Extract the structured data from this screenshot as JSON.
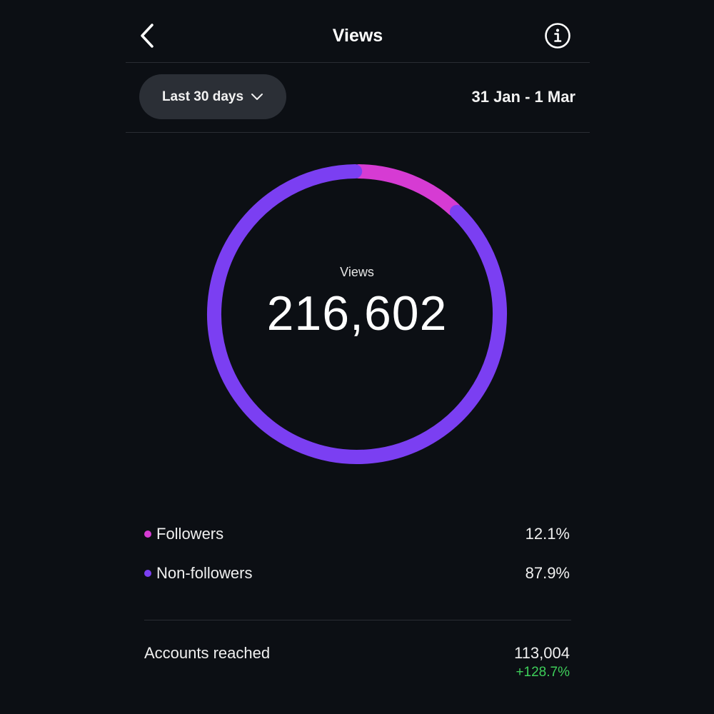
{
  "header": {
    "title": "Views",
    "back_icon": "chevron-left-icon",
    "info_icon": "info-icon"
  },
  "range": {
    "selected": "Last 30 days",
    "dropdown_icon": "chevron-down-icon",
    "dates": "31 Jan - 1 Mar"
  },
  "summary": {
    "label": "Views",
    "value": "216,602"
  },
  "chart_data": {
    "type": "pie",
    "categories": [
      "Followers",
      "Non-followers"
    ],
    "values": [
      12.1,
      87.9
    ],
    "colors": [
      "#d63bd3",
      "#7b3ff2"
    ]
  },
  "legend": [
    {
      "name": "Followers",
      "value": "12.1%",
      "color": "#d63bd3"
    },
    {
      "name": "Non-followers",
      "value": "87.9%",
      "color": "#7b3ff2"
    }
  ],
  "accounts": {
    "label": "Accounts reached",
    "value": "113,004",
    "change": "+128.7%",
    "change_color": "#3ecf5a"
  }
}
